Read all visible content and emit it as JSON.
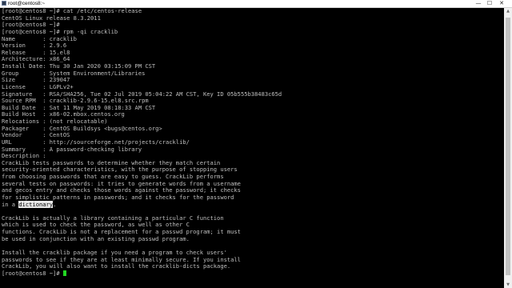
{
  "window": {
    "title": "root@centos8:~",
    "controls": {
      "minimize": "—",
      "maximize": "☐",
      "close": "✕"
    }
  },
  "terminal": {
    "lines": [
      {
        "text": "[root@centos8 ~]# cat /etc/centos-release"
      },
      {
        "text": "CentOS Linux release 8.3.2011"
      },
      {
        "text": "[root@centos8 ~]#"
      },
      {
        "text": "[root@centos8 ~]# rpm -qi cracklib"
      },
      {
        "text": "Name        : cracklib"
      },
      {
        "text": "Version     : 2.9.6"
      },
      {
        "text": "Release     : 15.el8"
      },
      {
        "text": "Architecture: x86_64"
      },
      {
        "text": "Install Date: Thu 30 Jan 2020 03:15:09 PM CST"
      },
      {
        "text": "Group       : System Environment/Libraries"
      },
      {
        "text": "Size        : 239047"
      },
      {
        "text": "License     : LGPLv2+"
      },
      {
        "text": "Signature   : RSA/SHA256, Tue 02 Jul 2019 05:04:22 AM CST, Key ID 05b555b38483c65d"
      },
      {
        "text": "Source RPM  : cracklib-2.9.6-15.el8.src.rpm"
      },
      {
        "text": "Build Date  : Sat 11 May 2019 08:18:33 AM CST"
      },
      {
        "text": "Build Host  : x86-02.mbox.centos.org"
      },
      {
        "text": "Relocations : (not relocatable)"
      },
      {
        "text": "Packager    : CentOS Buildsys <bugs@centos.org>"
      },
      {
        "text": "Vendor      : CentOS"
      },
      {
        "text": "URL         : http://sourceforge.net/projects/cracklib/"
      },
      {
        "text": "Summary     : A password-checking library"
      },
      {
        "text": "Description :"
      },
      {
        "text": "CrackLib tests passwords to determine whether they match certain"
      },
      {
        "text": "security-oriented characteristics, with the purpose of stopping users"
      },
      {
        "text": "from choosing passwords that are easy to guess. CrackLib performs"
      },
      {
        "text": "several tests on passwords: it tries to generate words from a username"
      },
      {
        "text": "and gecos entry and checks those words against the password; it checks"
      },
      {
        "text": "for simplistic patterns in passwords; and it checks for the password"
      },
      {
        "text": "in a ",
        "selected": "dictionary",
        "after": "."
      },
      {
        "text": ""
      },
      {
        "text": "CrackLib is actually a library containing a particular C function"
      },
      {
        "text": "which is used to check the password, as well as other C"
      },
      {
        "text": "functions. CrackLib is not a replacement for a passwd program; it must"
      },
      {
        "text": "be used in conjunction with an existing passwd program."
      },
      {
        "text": ""
      },
      {
        "text": "Install the cracklib package if you need a program to check users'"
      },
      {
        "text": "passwords to see if they are at least minimally secure. If you install"
      },
      {
        "text": "CrackLib, you will also want to install the cracklib-dicts package."
      },
      {
        "text": "[root@centos8 ~]# ",
        "cursor": true
      }
    ]
  },
  "colors": {
    "background": "#000000",
    "text": "#bfbfbf",
    "cursor": "#22d822",
    "selection": "#e6e6e6"
  },
  "scrollbar": {
    "up": "▲",
    "down": "▼"
  }
}
